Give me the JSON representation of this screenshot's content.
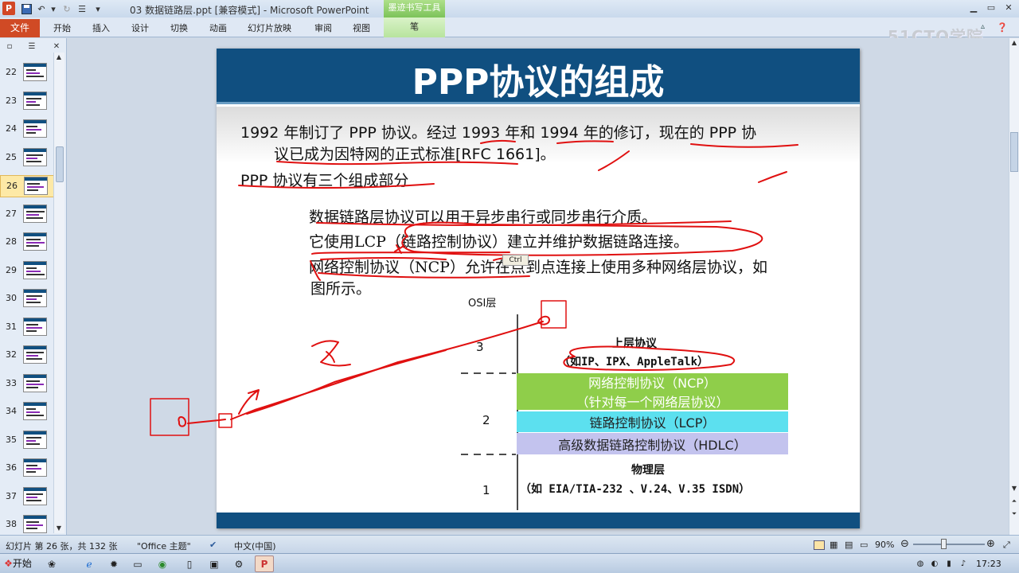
{
  "window": {
    "app_icon": "P",
    "title": "03 数据链路层.ppt [兼容模式] - Microsoft PowerPoint",
    "contextual_tab_group": "墨迹书写工具",
    "watermark": "51CTO学院"
  },
  "qat": {
    "save": "save-icon",
    "undo": "undo-icon",
    "redo": "redo-icon",
    "customize": "customize-icon"
  },
  "ribbon": {
    "file_tab": "文件",
    "tabs": [
      "开始",
      "插入",
      "设计",
      "切换",
      "动画",
      "幻灯片放映",
      "审阅",
      "视图"
    ],
    "pen_tab": "笔"
  },
  "thumbnails": {
    "numbers": [
      "22",
      "23",
      "24",
      "25",
      "26",
      "27",
      "28",
      "29",
      "30",
      "31",
      "32",
      "33",
      "34",
      "35",
      "36",
      "37",
      "38"
    ],
    "selected": "26"
  },
  "slide": {
    "title": "PPP协议的组成",
    "para1_line1": "1992 年制订了 PPP 协议。经过 1993 年和 1994 年的修订，现在的 PPP 协",
    "para1_line2": "议已成为因特网的正式标准[RFC 1661]。",
    "para2": "PPP 协议有三个组成部分",
    "bullet1": "数据链路层协议可以用于异步串行或同步串行介质。",
    "bullet2": "它使用LCP（链路控制协议）建立并维护数据链路连接。",
    "bullet3_line1": "网络控制协议（NCP）允许在点到点连接上使用多种网络层协议，如",
    "bullet3_line2": "图所示。",
    "bullet_glyph": "",
    "ctrl_tag": "Ctrl"
  },
  "diagram": {
    "osi_label": "OSI层",
    "layer3_num": "3",
    "layer2_num": "2",
    "layer1_num": "1",
    "upper_title": "上层协议",
    "upper_sub": "（如IP、IPX、AppleTalk）",
    "ncp_line1": "网络控制协议（NCP）",
    "ncp_line2": "（针对每一个网络层协议）",
    "lcp": "链路控制协议（LCP）",
    "hdlc": "高级数据链路控制协议（HDLC）",
    "phys_title": "物理层",
    "phys_sub": "（如 EIA/TIA-232 、V.24、V.35 ISDN）",
    "colors": {
      "ncp": "#8fce4a",
      "lcp": "#5ce0ef",
      "hdlc": "#c3c3ee"
    }
  },
  "ink_color": "#e01010",
  "statusbar": {
    "slide_info": "幻灯片 第 26 张，共 132 张",
    "theme": "\"Office 主题\"",
    "language": "中文(中国)",
    "zoom": "90%",
    "zoom_value": 0.9
  },
  "taskbar": {
    "start": "开始",
    "time": "17:23"
  }
}
